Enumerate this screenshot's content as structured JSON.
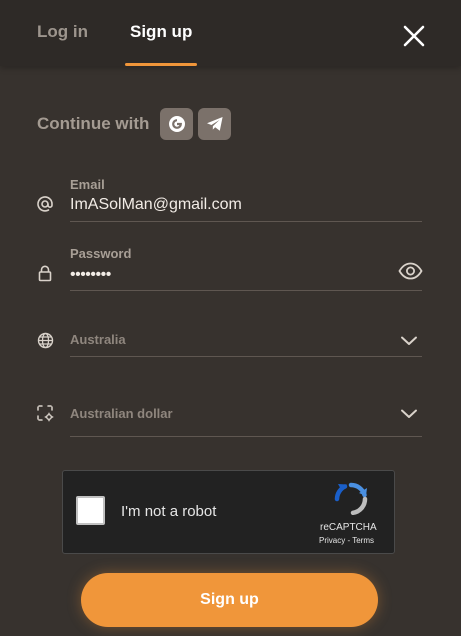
{
  "tabs": {
    "login": "Log in",
    "signup": "Sign up"
  },
  "social": {
    "continue_label": "Continue with",
    "providers": [
      "google-icon",
      "telegram-icon"
    ]
  },
  "email": {
    "label": "Email",
    "value": "ImASolMan@gmail.com"
  },
  "password": {
    "label": "Password",
    "masked_value": "••••••••"
  },
  "country": {
    "selected": "Australia"
  },
  "currency": {
    "selected": "Australian dollar"
  },
  "captcha": {
    "label": "I'm not a robot",
    "brand": "reCAPTCHA",
    "privacy": "Privacy",
    "separator": " - ",
    "terms": "Terms"
  },
  "submit": {
    "label": "Sign up"
  },
  "colors": {
    "background": "#37322e",
    "header": "#2e2a27",
    "accent": "#f0963a",
    "social_button": "#7b716a"
  }
}
